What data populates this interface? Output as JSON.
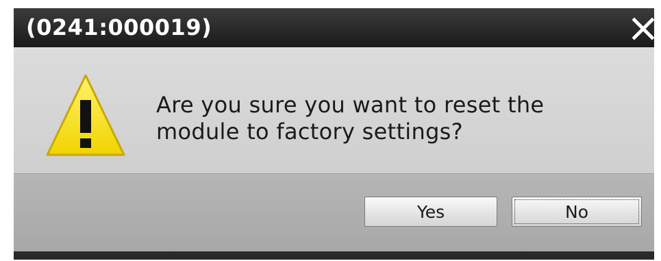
{
  "dialog": {
    "title": "(0241:000019)",
    "message_line1": "Are you sure you want to reset the",
    "message_line2": "module to factory settings?",
    "yes_label": "Yes",
    "no_label": "No",
    "icons": {
      "warning": "warning-icon",
      "close": "close-icon"
    }
  },
  "colors": {
    "titlebar": "#1f1f1f",
    "content_bg": "#d4d4d4",
    "footer_bg": "#b0b0b0",
    "warning_yellow": "#f5e21c"
  }
}
